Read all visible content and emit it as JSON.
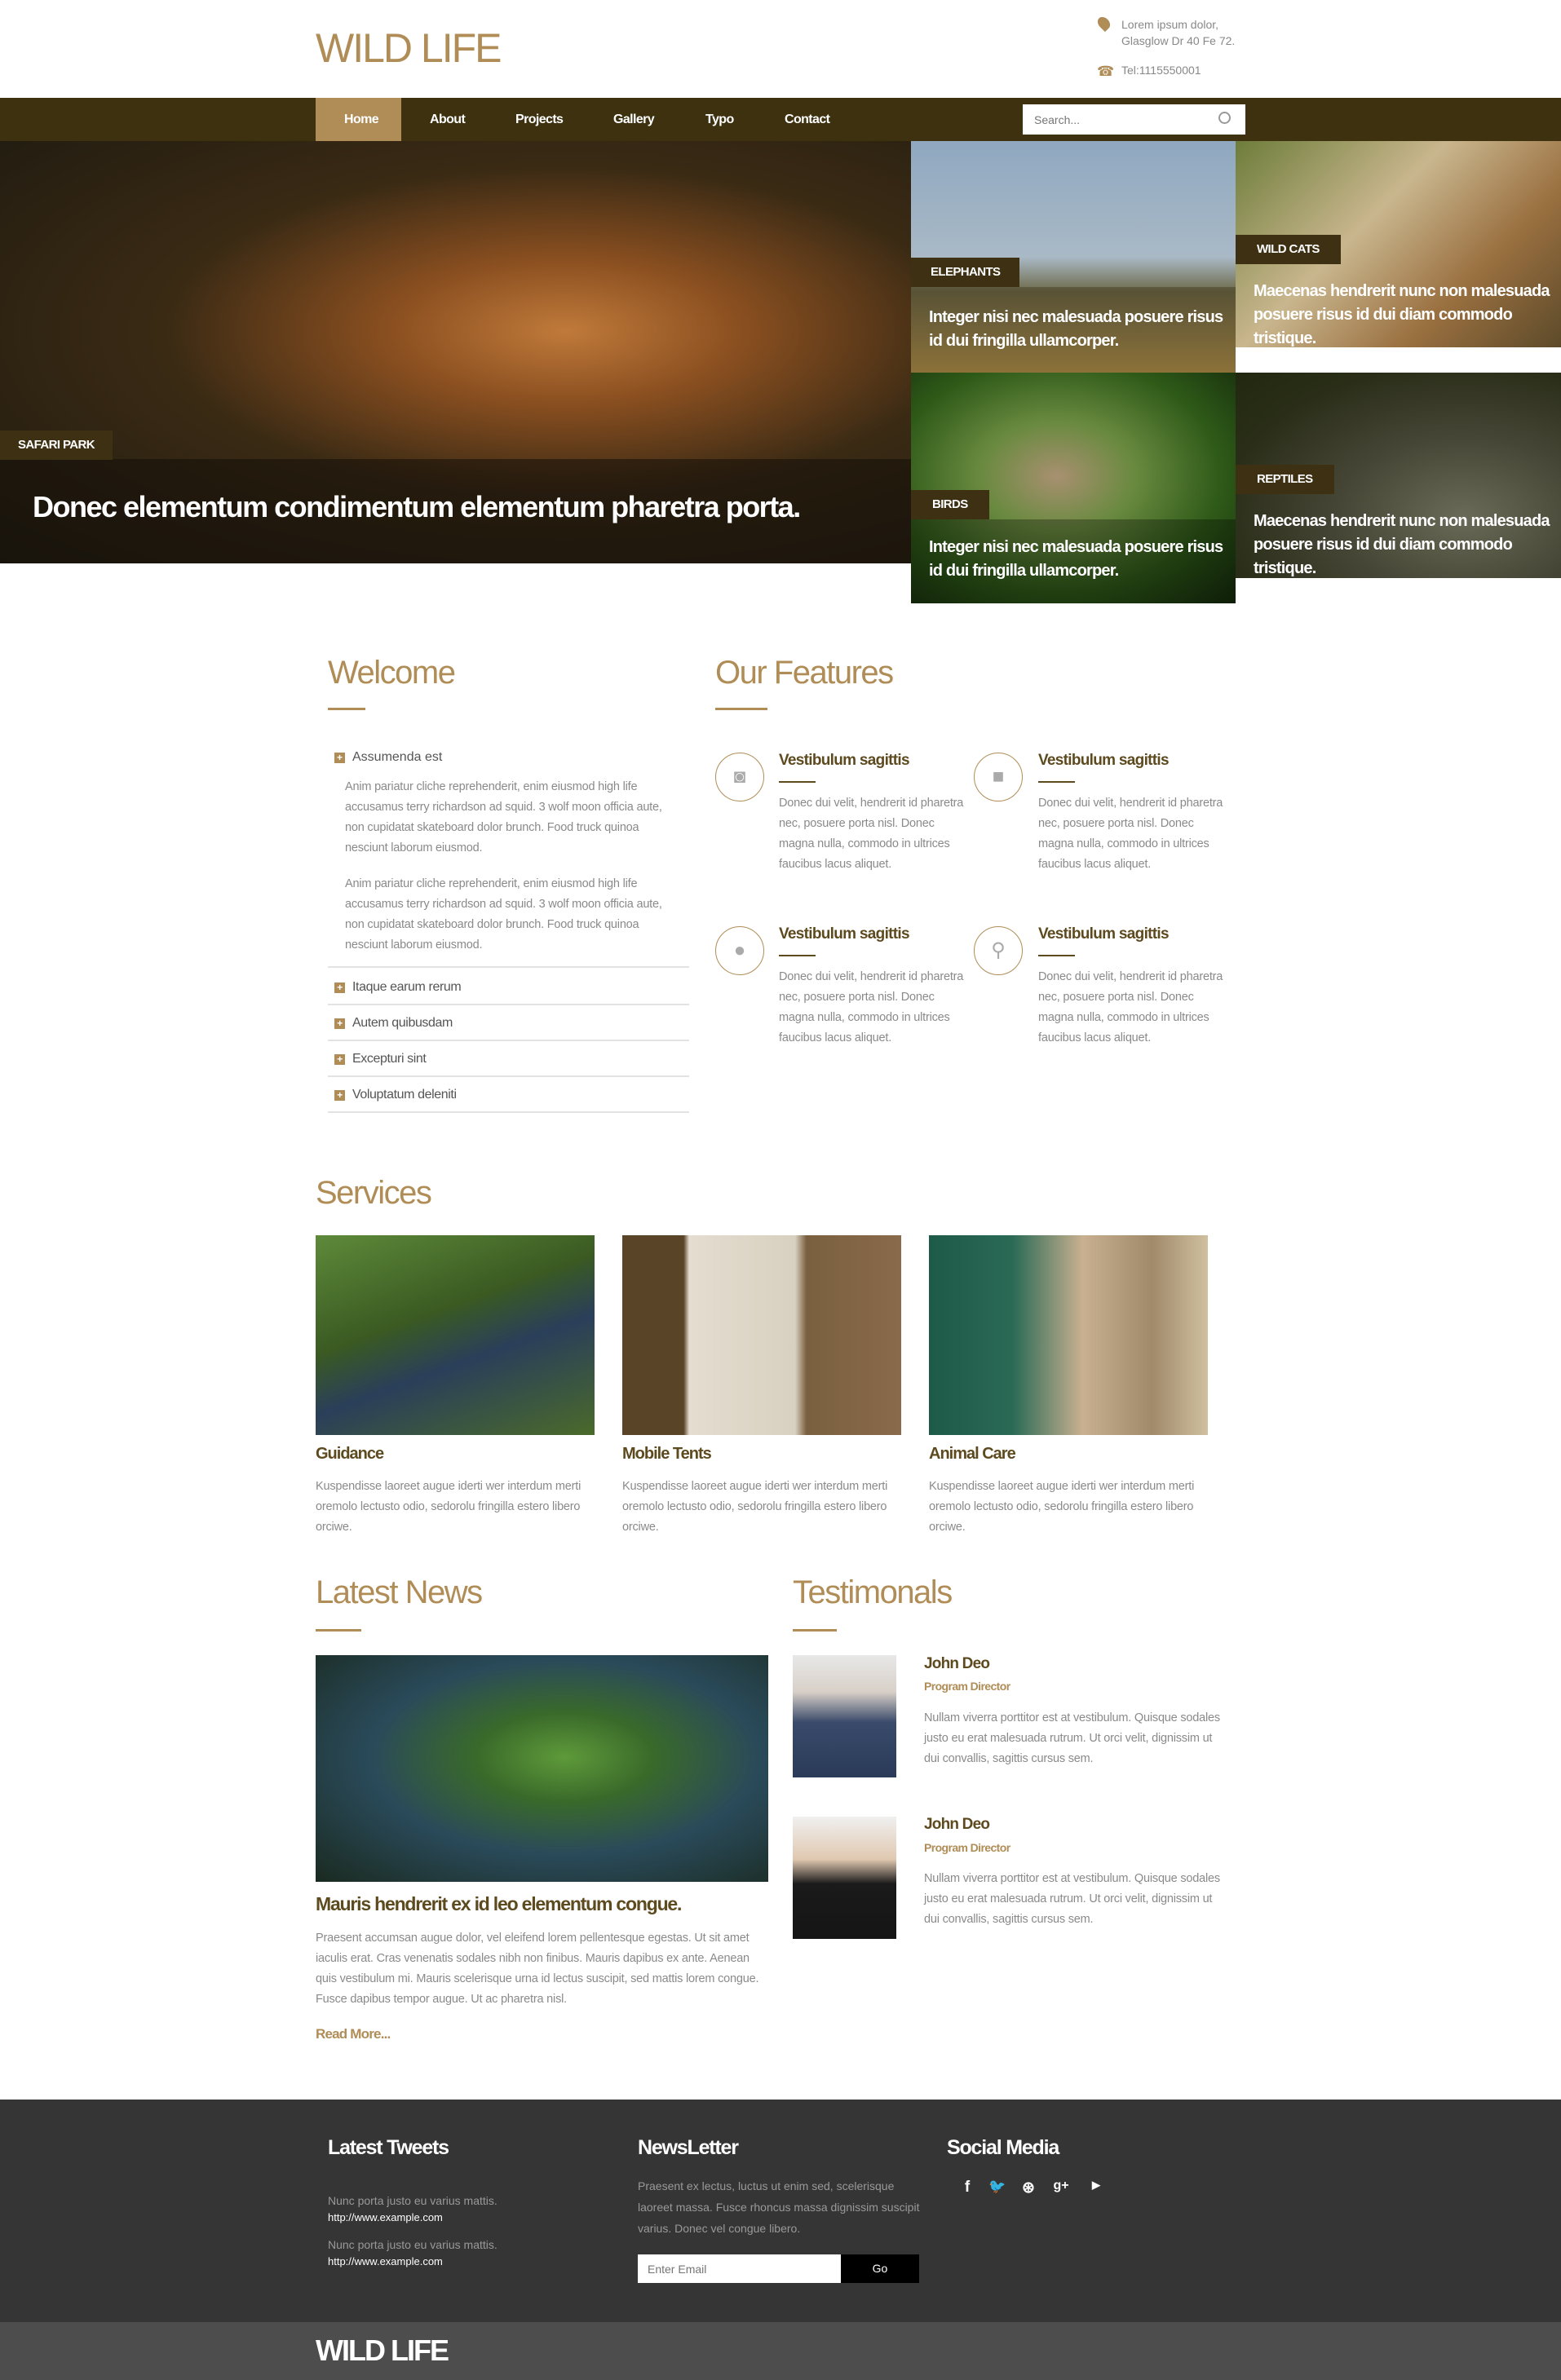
{
  "colors": {
    "accent": "#b08d57",
    "nav_bg": "#3d310f",
    "label_bg": "#3e3012",
    "footer_bg": "#353535",
    "bottom_bg": "#4d4d4d"
  },
  "header": {
    "logo": "WILD LIFE",
    "address_line1": "Lorem ipsum dolor,",
    "address_line2": "Glasglow Dr 40 Fe 72.",
    "tel": "Tel:1115550001",
    "address_icon": "map-marker-icon",
    "tel_icon": "phone-icon"
  },
  "nav": {
    "items": [
      "Home",
      "About",
      "Projects",
      "Gallery",
      "Typo",
      "Contact"
    ],
    "active": "Home",
    "search_placeholder": "Search...",
    "search_icon": "search-icon"
  },
  "hero": {
    "main": {
      "label": "SAFARI PARK",
      "caption": "Donec elementum condimentum elementum pharetra porta."
    },
    "tiles": [
      {
        "label": "ELEPHANTS",
        "caption": "Integer nisi nec malesuada posuere risus id dui fringilla ullamcorper."
      },
      {
        "label": "WILD CATS",
        "caption": "Maecenas hendrerit nunc non malesuada posuere risus id dui diam commodo tristique."
      },
      {
        "label": "BIRDS",
        "caption": "Integer nisi nec malesuada posuere risus id dui fringilla ullamcorper."
      },
      {
        "label": "REPTILES",
        "caption": "Maecenas hendrerit nunc non malesuada posuere risus id dui diam commodo tristique."
      }
    ]
  },
  "welcome": {
    "title": "Welcome",
    "accordion": [
      {
        "title": "Assumenda est",
        "open": true,
        "paragraphs": [
          "Anim pariatur cliche reprehenderit, enim eiusmod high life accusamus terry richardson ad squid. 3 wolf moon officia aute, non cupidatat skateboard dolor brunch. Food truck quinoa nesciunt laborum eiusmod.",
          "Anim pariatur cliche reprehenderit, enim eiusmod high life accusamus terry richardson ad squid. 3 wolf moon officia aute, non cupidatat skateboard dolor brunch. Food truck quinoa nesciunt laborum eiusmod."
        ]
      },
      {
        "title": "Itaque earum rerum"
      },
      {
        "title": "Autem quibusdam"
      },
      {
        "title": "Excepturi sint"
      },
      {
        "title": "Voluptatum deleniti"
      }
    ]
  },
  "features": {
    "title": "Our Features",
    "items": [
      {
        "icon": "camera-icon",
        "title": "Vestibulum sagittis",
        "text": "Donec dui velit, hendrerit id pharetra nec, posuere porta nisl. Donec magna nulla, commodo in ultrices faucibus lacus aliquet."
      },
      {
        "icon": "video-camera-icon",
        "title": "Vestibulum sagittis",
        "text": "Donec dui velit, hendrerit id pharetra nec, posuere porta nisl. Donec magna nulla, commodo in ultrices faucibus lacus aliquet."
      },
      {
        "icon": "globe-icon",
        "title": "Vestibulum sagittis",
        "text": "Donec dui velit, hendrerit id pharetra nec, posuere porta nisl. Donec magna nulla, commodo in ultrices faucibus lacus aliquet."
      },
      {
        "icon": "map-marker-icon",
        "title": "Vestibulum sagittis",
        "text": "Donec dui velit, hendrerit id pharetra nec, posuere porta nisl. Donec magna nulla, commodo in ultrices faucibus lacus aliquet."
      }
    ]
  },
  "services": {
    "title": "Services",
    "items": [
      {
        "title": "Guidance",
        "text": "Kuspendisse laoreet augue iderti wer interdum merti oremolo lectusto odio, sedorolu fringilla estero libero orciwe."
      },
      {
        "title": "Mobile Tents",
        "text": "Kuspendisse laoreet augue iderti wer interdum merti oremolo lectusto odio, sedorolu fringilla estero libero orciwe."
      },
      {
        "title": "Animal Care",
        "text": "Kuspendisse laoreet augue iderti wer interdum merti oremolo lectusto odio, sedorolu fringilla estero libero orciwe."
      }
    ]
  },
  "news": {
    "title": "Latest News",
    "headline": "Mauris hendrerit ex id leo elementum congue.",
    "text": "Praesent accumsan augue dolor, vel eleifend lorem pellentesque egestas. Ut sit amet iaculis erat. Cras venenatis sodales nibh non finibus. Mauris dapibus ex ante. Aenean quis vestibulum mi. Mauris scelerisque urna id lectus suscipit, sed mattis lorem congue. Fusce dapibus tempor augue. Ut ac pharetra nisl.",
    "read_more": "Read More..."
  },
  "testimonials": {
    "title": "Testimonals",
    "items": [
      {
        "name": "John Deo",
        "role": "Program Director",
        "text": "Nullam viverra porttitor est at vestibulum. Quisque sodales justo eu erat malesuada rutrum. Ut orci velit, dignissim ut dui convallis, sagittis cursus sem."
      },
      {
        "name": "John Deo",
        "role": "Program Director",
        "text": "Nullam viverra porttitor est at vestibulum. Quisque sodales justo eu erat malesuada rutrum. Ut orci velit, dignissim ut dui convallis, sagittis cursus sem."
      }
    ]
  },
  "footer": {
    "tweets": {
      "title": "Latest Tweets",
      "items": [
        {
          "text": "Nunc porta justo eu varius mattis.",
          "link": "http://www.example.com"
        },
        {
          "text": "Nunc porta justo eu varius mattis.",
          "link": "http://www.example.com"
        }
      ]
    },
    "newsletter": {
      "title": "NewsLetter",
      "text": "Praesent ex lectus, luctus ut enim sed, scelerisque laoreet massa. Fusce rhoncus massa dignissim suscipit varius. Donec vel congue libero.",
      "placeholder": "Enter Email",
      "button": "Go"
    },
    "social": {
      "title": "Social Media",
      "icons": [
        "facebook-icon",
        "twitter-icon",
        "dribbble-icon",
        "google-plus-icon",
        "youtube-icon"
      ]
    },
    "bottom_logo": "WILD LIFE"
  }
}
